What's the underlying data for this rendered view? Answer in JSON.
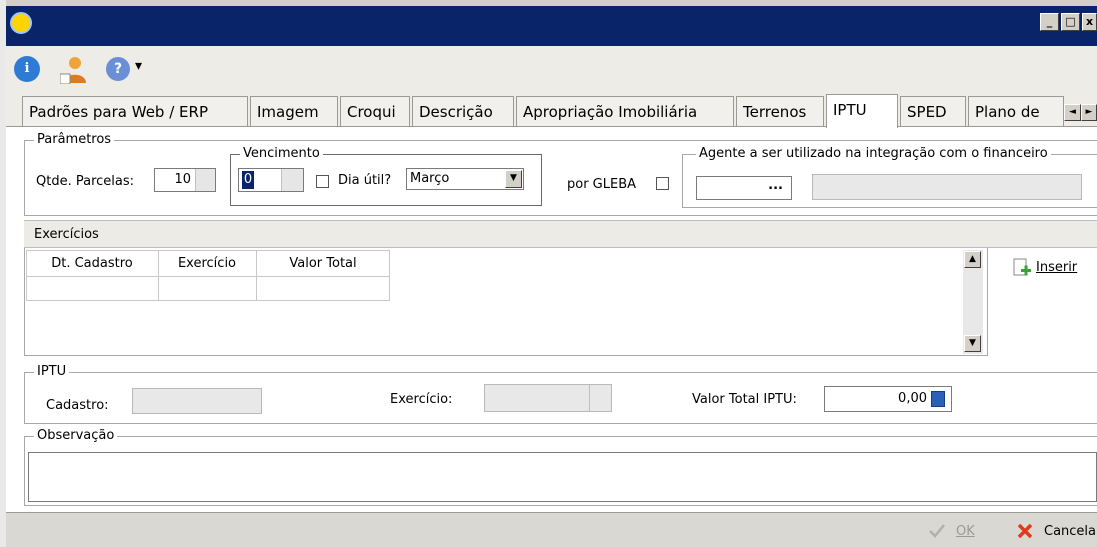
{
  "window": {
    "minimize_label": "_",
    "maximize_label": "□",
    "close_label": "x"
  },
  "toolbar": {
    "dropdown_arrow": "▾"
  },
  "tabs": [
    {
      "label": "Padrões para Web / ERP"
    },
    {
      "label": "Imagem"
    },
    {
      "label": "Croqui"
    },
    {
      "label": "Descrição"
    },
    {
      "label": "Apropriação Imobiliária"
    },
    {
      "label": "Terrenos"
    },
    {
      "label": "IPTU",
      "active": true
    },
    {
      "label": "SPED"
    },
    {
      "label": "Plano de"
    }
  ],
  "tab_scroll": {
    "left": "◄",
    "right": "►"
  },
  "parametros": {
    "legend": "Parâmetros",
    "qtde_parcelas_label": "Qtde. Parcelas:",
    "qtde_parcelas_value": "10",
    "vencimento": {
      "legend": "Vencimento",
      "day_value": "0",
      "dia_util_label": "Dia útil?",
      "month_value": "Março"
    },
    "por_gleba_label": "por GLEBA",
    "agente": {
      "legend": "Agente a ser utilizado na integração com o financeiro",
      "ellipsis": "..."
    }
  },
  "exercicios": {
    "title": "Exercícios",
    "columns": [
      "Dt. Cadastro",
      "Exercício",
      "Valor Total"
    ],
    "inserir_label": "Inserir"
  },
  "iptu": {
    "legend": "IPTU",
    "cadastro_label": "Cadastro:",
    "exercicio_label": "Exercício:",
    "valor_total_label": "Valor Total IPTU:",
    "valor_total_value": "0,00"
  },
  "observacao": {
    "legend": "Observação"
  },
  "footer": {
    "ok_label": "OK",
    "cancel_label": "Cancela"
  },
  "colors": {
    "titlebar": "#0a246a",
    "accent_green": "#3aa335",
    "cancel_red": "#e03a1e"
  }
}
